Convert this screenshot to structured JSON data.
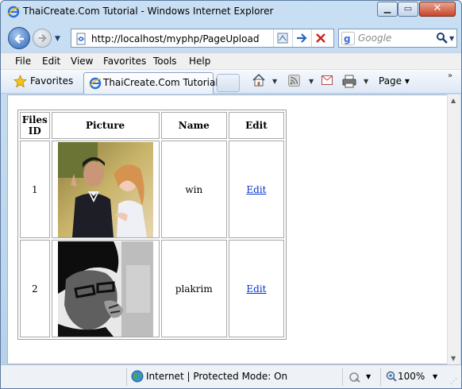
{
  "window": {
    "title": "ThaiCreate.Com Tutorial - Windows Internet Explorer",
    "min_glyph": "▁",
    "max_glyph": "▭",
    "close_glyph": "✕"
  },
  "addressbar": {
    "url": "http://localhost/myphp/PageUploadTo"
  },
  "search": {
    "placeholder": "Google"
  },
  "menubar": {
    "items": [
      "File",
      "Edit",
      "View",
      "Favorites",
      "Tools",
      "Help"
    ]
  },
  "favorites": {
    "label": "Favorites",
    "tab_label": "ThaiCreate.Com Tutorial",
    "page_label": "Page"
  },
  "table": {
    "headers": [
      "Files ID",
      "Picture",
      "Name",
      "Edit"
    ],
    "rows": [
      {
        "id": "1",
        "name": "win",
        "edit": "Edit"
      },
      {
        "id": "2",
        "name": "plakrim",
        "edit": "Edit"
      }
    ]
  },
  "statusbar": {
    "zone": "Internet | Protected Mode: On",
    "zoom": "100%"
  },
  "icons": {
    "back": "arrow-left-icon",
    "forward": "arrow-right-icon",
    "favorites": "star-icon",
    "home": "home-icon",
    "feeds": "rss-icon",
    "mail": "mail-icon",
    "print": "printer-icon"
  },
  "colors": {
    "link": "#0033cc",
    "chrome": "#c9dff3"
  }
}
